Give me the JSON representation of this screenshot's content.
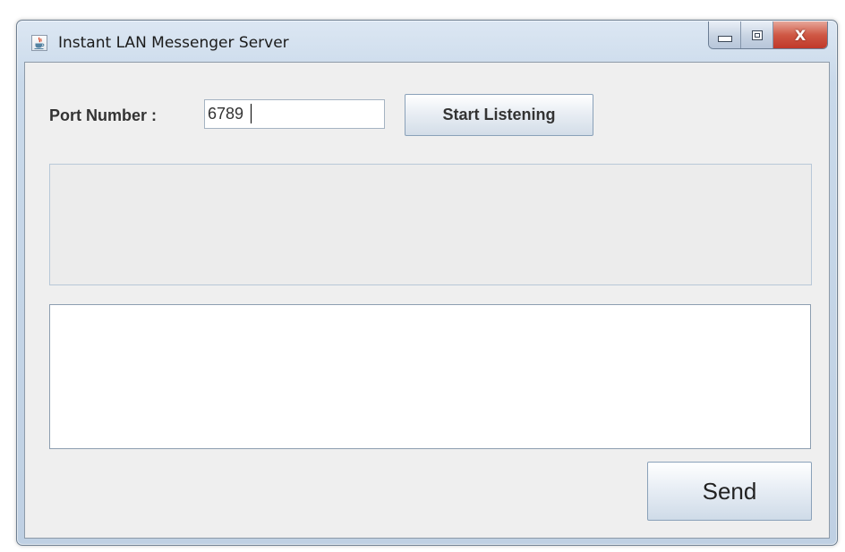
{
  "window": {
    "title": "Instant LAN Messenger Server",
    "icon": "java-cup-icon",
    "controls": {
      "minimize_icon": "minimize-icon",
      "maximize_icon": "maximize-icon",
      "close_label": "X"
    }
  },
  "form": {
    "port_label": "Port Number :",
    "port_value": "6789",
    "start_button_label": "Start Listening"
  },
  "log": {
    "text": ""
  },
  "message": {
    "text": ""
  },
  "send_button_label": "Send",
  "colors": {
    "content_background": "#efefef",
    "close_button": "#c9483a",
    "title_bar": "#c9d9ea"
  }
}
